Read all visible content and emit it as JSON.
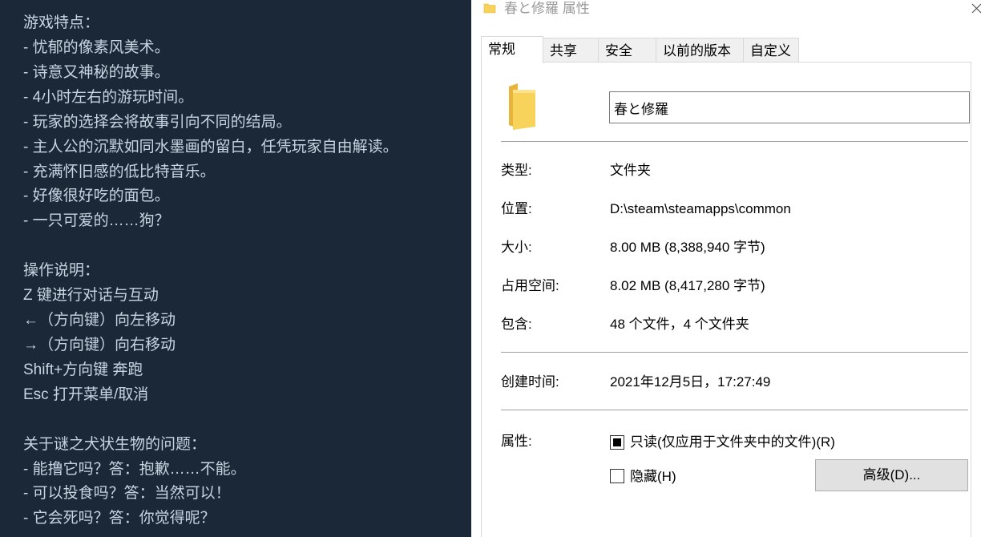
{
  "description": {
    "lines": [
      "游戏特点：",
      "- 忧郁的像素风美术。",
      "- 诗意又神秘的故事。",
      "- 4小时左右的游玩时间。",
      "- 玩家的选择会将故事引向不同的结局。",
      "- 主人公的沉默如同水墨画的留白，任凭玩家自由解读。",
      "- 充满怀旧感的低比特音乐。",
      "- 好像很好吃的面包。",
      "- 一只可爱的……狗？",
      "",
      "操作说明：",
      "Z 键进行对话与互动",
      "←（方向键）向左移动",
      "→（方向键）向右移动",
      "Shift+方向键 奔跑",
      "Esc 打开菜单/取消",
      "",
      "关于谜之犬状生物的问题：",
      "- 能撸它吗？答：抱歉……不能。",
      "- 可以投食吗？答：当然可以！",
      "- 它会死吗？答：你觉得呢？"
    ]
  },
  "window": {
    "title": "春と修羅 属性",
    "icon": "folder-icon",
    "close_icon": "close-icon"
  },
  "tabs": [
    "常规",
    "共享",
    "安全",
    "以前的版本",
    "自定义"
  ],
  "active_tab": "常规",
  "general": {
    "name_value": "春と修羅",
    "type_label": "类型:",
    "type_value": "文件夹",
    "location_label": "位置:",
    "location_value": "D:\\steam\\steamapps\\common",
    "size_label": "大小:",
    "size_value": "8.00 MB (8,388,940 字节)",
    "disk_label": "占用空间:",
    "disk_value": "8.02 MB (8,417,280 字节)",
    "contains_label": "包含:",
    "contains_value": "48 个文件，4 个文件夹",
    "created_label": "创建时间:",
    "created_value": "2021年12月5日，17:27:49",
    "attributes_label": "属性:",
    "readonly_label": "只读(仅应用于文件夹中的文件)(R)",
    "readonly_state": "indeterminate",
    "hidden_label": "隐藏(H)",
    "hidden_checked": false,
    "advanced_button": "高级(D)..."
  },
  "colors": {
    "left_bg": "#1b2838",
    "left_text": "#c7d5e0",
    "folder_yellow": "#f7d35c"
  }
}
